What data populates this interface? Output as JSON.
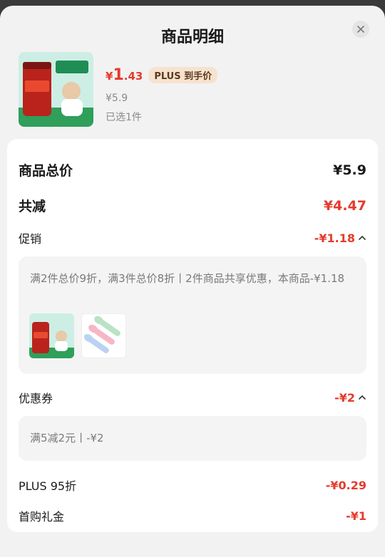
{
  "header": {
    "title": "商品明细"
  },
  "product": {
    "price_yen": "¥",
    "price_int": "1",
    "price_dec": ".43",
    "plus_badge": "PLUS 到手价",
    "original_price": "¥5.9",
    "selected_count": "已选1件",
    "thumb_text_1": "香甜不腻",
    "thumb_text_2": "色泽红亮",
    "thumb_tag": "调味酱"
  },
  "summary": {
    "total_label": "商品总价",
    "total_value": "¥5.9",
    "discount_label": "共减",
    "discount_value": "¥4.47"
  },
  "promo": {
    "label": "促销",
    "value": "-¥1.18",
    "desc": "满2件总价9折，满3件总价8折丨2件商品共享优惠，本商品-¥1.18"
  },
  "coupon": {
    "label": "优惠券",
    "value": "-¥2",
    "desc": "满5减2元丨-¥2"
  },
  "plus": {
    "label": "PLUS 95折",
    "value": "-¥0.29"
  },
  "first_buy": {
    "label": "首购礼金",
    "value": "-¥1"
  },
  "colors": {
    "accent_red": "#e53b2c",
    "badge_bg": "#f7e2cf",
    "product_green": "#2f9f5a"
  },
  "icons": [
    "close-icon",
    "chevron-up-icon"
  ]
}
